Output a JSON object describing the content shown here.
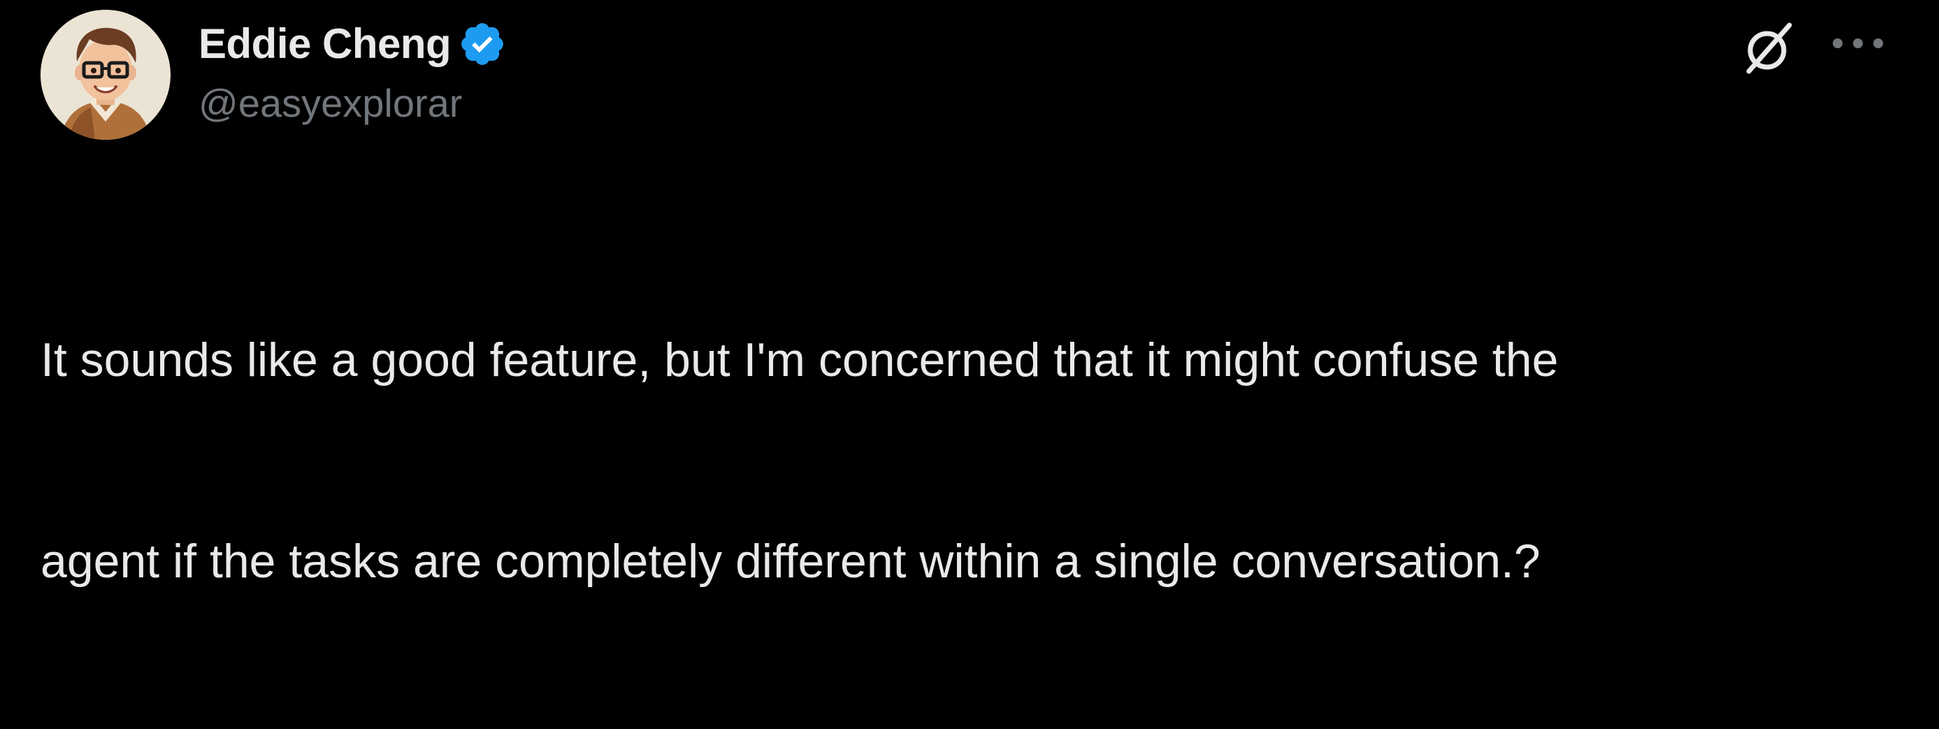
{
  "tweet": {
    "author": {
      "display_name": "Eddie Cheng",
      "handle": "@easyexplorar",
      "verified": true,
      "avatar": "cartoon-avatar-with-glasses"
    },
    "actions": {
      "grok_icon": "grok-slash-icon",
      "more_icon": "more-horizontal-icon"
    },
    "text_lines": [
      "It sounds like a good feature, but I'm concerned that it might confuse the",
      "agent if the tasks are completely different within a single conversation.?"
    ]
  },
  "colors": {
    "background": "#000000",
    "primary_text": "#e7e9ea",
    "secondary_text": "#71767b",
    "verified_badge": "#1d9bf0"
  }
}
